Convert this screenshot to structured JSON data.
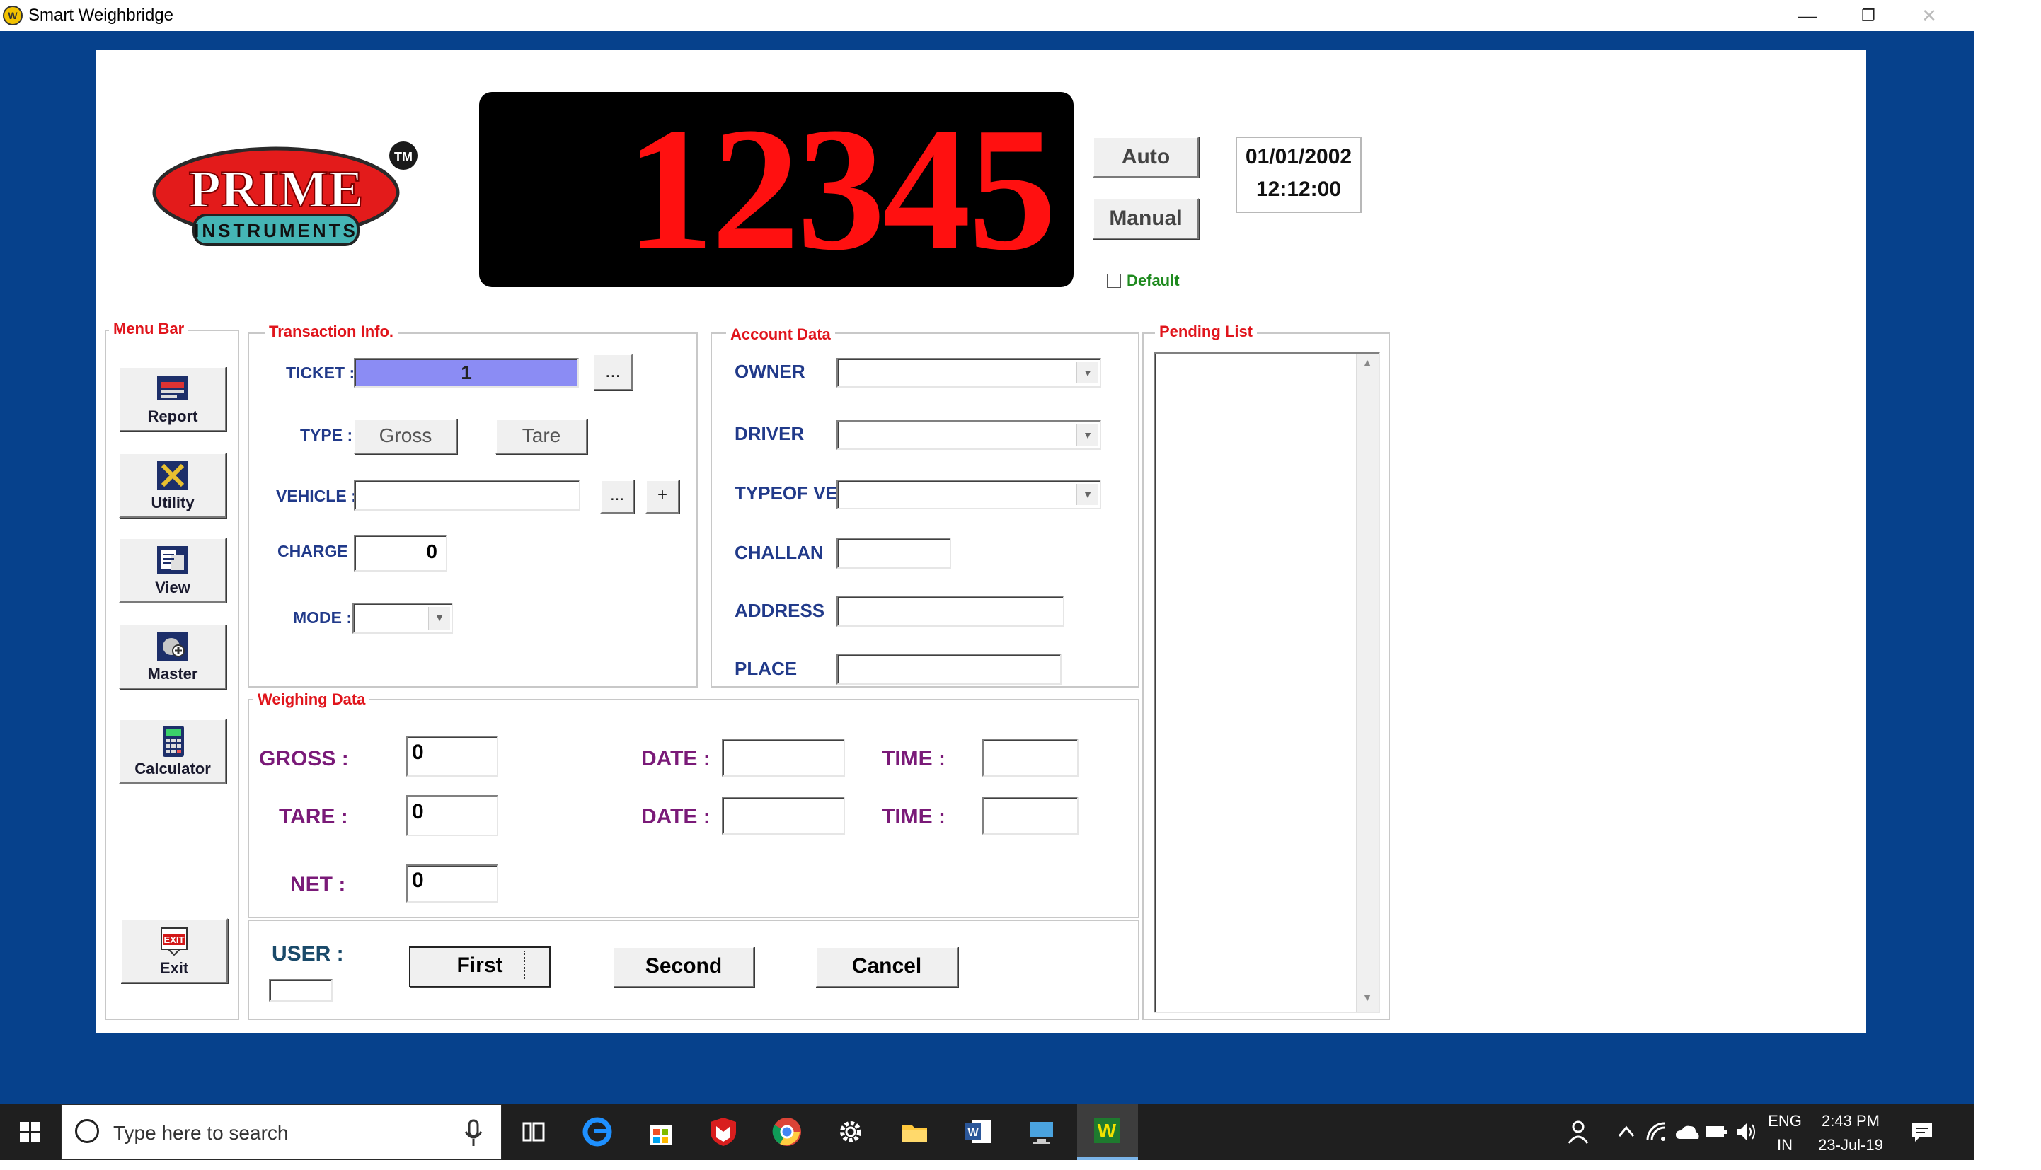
{
  "window": {
    "title": "Smart Weighbridge",
    "app_icon": "weighbridge-logo-icon",
    "controls": [
      "minimize-icon",
      "restore-icon",
      "close-icon"
    ]
  },
  "logo": {
    "brand": "PRIME",
    "sub": "INSTRUMENTS",
    "tm": "TM"
  },
  "display": {
    "weight": "12345",
    "color": "#ff1010"
  },
  "mode_buttons": {
    "auto": "Auto",
    "manual": "Manual"
  },
  "clock": {
    "date": "01/01/2002",
    "time": "12:12:00"
  },
  "default_checkbox": {
    "label": "Default",
    "checked": false
  },
  "menu_bar": {
    "title": "Menu Bar",
    "items": [
      {
        "label": "Report",
        "icon": "report-icon"
      },
      {
        "label": "Utility",
        "icon": "utility-icon"
      },
      {
        "label": "View",
        "icon": "view-icon"
      },
      {
        "label": "Master",
        "icon": "master-icon"
      },
      {
        "label": "Calculator",
        "icon": "calculator-icon"
      }
    ],
    "exit": {
      "label": "Exit",
      "icon": "exit-icon"
    }
  },
  "transaction": {
    "title": "Transaction Info.",
    "ticket_label": "TICKET :",
    "ticket_value": "1",
    "ticket_browse": "...",
    "type_label": "TYPE :",
    "type_gross": "Gross",
    "type_tare": "Tare",
    "vehicle_label": "VEHICLE :",
    "vehicle_value": "",
    "vehicle_browse": "...",
    "vehicle_add": "+",
    "charge_label": "CHARGE :",
    "charge_value": "0",
    "mode_label": "MODE :",
    "mode_value": ""
  },
  "account": {
    "title": "Account Data",
    "owner_label": "OWNER",
    "driver_label": "DRIVER",
    "typeofve_label": "TYPEOF VE",
    "challan_label": "CHALLAN",
    "address_label": "ADDRESS",
    "place_label": "PLACE"
  },
  "pending": {
    "title": "Pending List",
    "items": []
  },
  "weighing": {
    "title": "Weighing Data",
    "gross_label": "GROSS :",
    "gross_value": "0",
    "tare_label": "TARE :",
    "tare_value": "0",
    "net_label": "NET :",
    "net_value": "0",
    "date_label": "DATE :",
    "time_label": "TIME :"
  },
  "actions": {
    "user_label": "USER :",
    "user_value": "",
    "first": "First",
    "second": "Second",
    "cancel": "Cancel"
  },
  "taskbar": {
    "search_placeholder": "Type here to search",
    "lang_top": "ENG",
    "lang_bottom": "IN",
    "time": "2:43 PM",
    "date": "23-Jul-19"
  }
}
